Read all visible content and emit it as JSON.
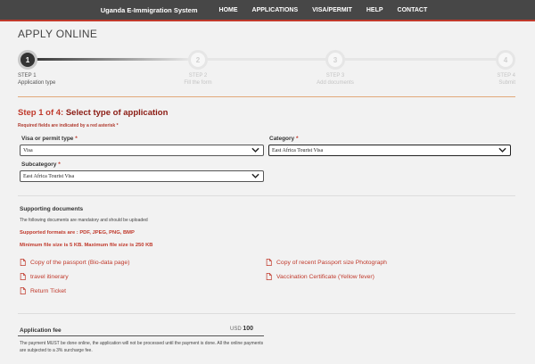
{
  "nav": {
    "brand": "Uganda E-Immigration System",
    "links": [
      "HOME",
      "APPLICATIONS",
      "VISA/PERMIT",
      "HELP",
      "CONTACT"
    ]
  },
  "page_title": "APPLY ONLINE",
  "stepper": {
    "steps": [
      {
        "number": "1",
        "label": "STEP 1",
        "sub": "Application type",
        "active": true
      },
      {
        "number": "2",
        "label": "STEP 2",
        "sub": "Fill the form",
        "active": false
      },
      {
        "number": "3",
        "label": "STEP 3",
        "sub": "Add documents",
        "active": false
      },
      {
        "number": "4",
        "label": "STEP 4",
        "sub": "Submit",
        "active": false
      }
    ]
  },
  "form": {
    "heading_prefix": "Step 1 of 4:",
    "heading_main": "Select type of application",
    "required_note": "Required fields are indicated by a red asterisk",
    "required_star": "*",
    "visa_type_label": "Visa or permit type",
    "visa_type_value": "Visa",
    "category_label": "Category",
    "category_value": "East Africa Tourist Visa",
    "subcategory_label": "Subcategory",
    "subcategory_value": "East Africa Tourist Visa"
  },
  "supporting": {
    "title": "Supporting documents",
    "note": "The following documents are mandatory and should be uploaded",
    "formats": "Supported formats are : PDF, JPEG, PNG, BMP",
    "sizes": "Minimum file size is 5 KB. Maximum file size is 250 KB",
    "documents_left": [
      "Copy of the passport (Bio-data page)",
      "travel itinerary",
      "Return Ticket"
    ],
    "documents_right": [
      "Copy of recent Passport size Photograph",
      "Vaccination Certificate (Yellow fever)"
    ]
  },
  "fee": {
    "title": "Application fee",
    "currency": "USD",
    "amount": "100",
    "note": "The payment MUST be done online, the application will not be processed until the payment is done. All the online payments are subjected to a 3% surcharge fee."
  },
  "colors": {
    "nav_bg": "#474747",
    "accent_red": "#c0392b",
    "dark_red": "#8a1a12"
  }
}
